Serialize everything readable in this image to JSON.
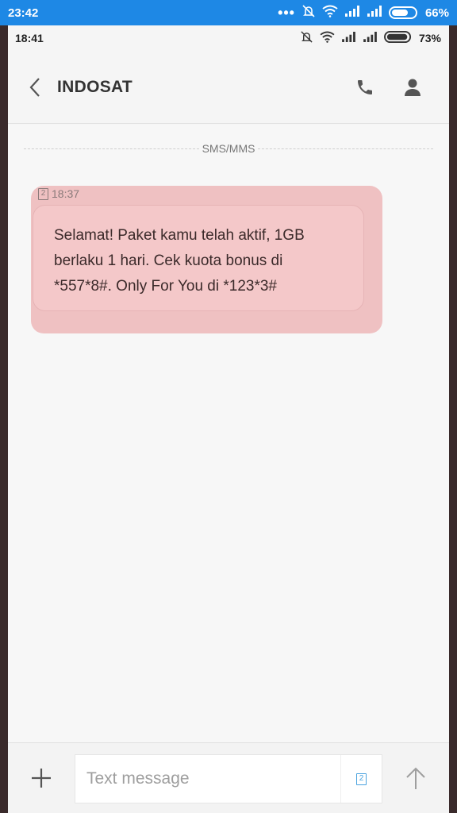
{
  "outer_status": {
    "time": "23:42",
    "battery": "66%",
    "icons": [
      "more-dots-icon",
      "mute-icon",
      "wifi-icon",
      "signal-icon",
      "signal-icon",
      "battery-icon"
    ]
  },
  "inner_status": {
    "time": "18:41",
    "battery": "73%",
    "icons": [
      "mute-icon",
      "wifi-icon",
      "signal-icon",
      "signal-icon",
      "battery-icon"
    ]
  },
  "header": {
    "title": "INDOSAT",
    "icons": [
      "back-chevron-icon",
      "phone-icon",
      "contact-icon"
    ]
  },
  "conversation": {
    "divider_label": "SMS/MMS",
    "messages": [
      {
        "sim": "2",
        "time": "18:37",
        "text": "Selamat! Paket kamu telah aktif, 1GB berlaku 1 hari. Cek kuota bonus di *557*8#. Only For You di *123*3#"
      }
    ]
  },
  "composer": {
    "placeholder": "Text message",
    "sim": "2",
    "icons": [
      "plus-icon",
      "sim-card-icon",
      "send-arrow-icon"
    ]
  },
  "colors": {
    "outer_status_bg": "#1e88e5",
    "bubble_bg": "#f4c8c9",
    "highlight_bg": "#efc1c2",
    "page_bg": "#f5f5f5"
  }
}
